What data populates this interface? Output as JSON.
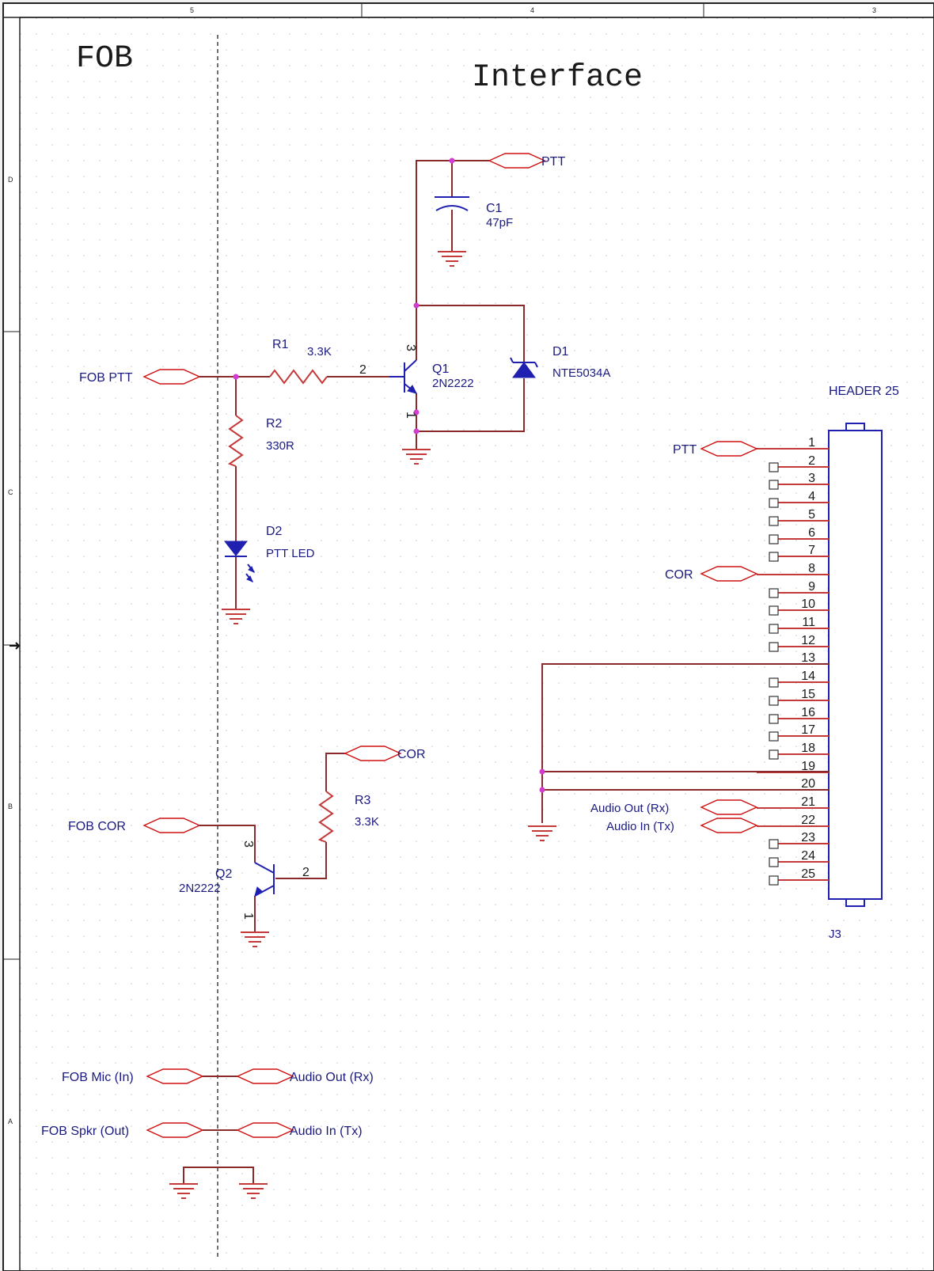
{
  "border": {
    "zones_top": [
      "5",
      "4",
      "3"
    ],
    "zones_left": [
      "D",
      "C",
      "B",
      "A"
    ]
  },
  "sections": {
    "left": "FOB",
    "right": "Interface"
  },
  "ports": {
    "fob_ptt": "FOB PTT",
    "ptt_top": "PTT",
    "fob_cor": "FOB COR",
    "cor": "COR",
    "fob_mic": "FOB Mic (In)",
    "fob_spkr": "FOB Spkr (Out)",
    "audio_out": "Audio Out (Rx)",
    "audio_in": "Audio In (Tx)",
    "hdr_ptt": "PTT",
    "hdr_cor": "COR",
    "hdr_audio_out": "Audio Out (Rx)",
    "hdr_audio_in": "Audio In (Tx)"
  },
  "components": {
    "c1": {
      "ref": "C1",
      "value": "47pF"
    },
    "r1": {
      "ref": "R1",
      "value": "3.3K"
    },
    "r2": {
      "ref": "R2",
      "value": "330R"
    },
    "r3": {
      "ref": "R3",
      "value": "3.3K"
    },
    "q1": {
      "ref": "Q1",
      "value": "2N2222",
      "pins": [
        "1",
        "2",
        "3"
      ]
    },
    "q2": {
      "ref": "Q2",
      "value": "2N2222",
      "pins": [
        "1",
        "2",
        "3"
      ]
    },
    "d1": {
      "ref": "D1",
      "value": "NTE5034A"
    },
    "d2": {
      "ref": "D2",
      "value": "PTT LED"
    },
    "j3": {
      "ref": "J3",
      "value": "HEADER 25",
      "pins": [
        "1",
        "2",
        "3",
        "4",
        "5",
        "6",
        "7",
        "8",
        "9",
        "10",
        "11",
        "12",
        "13",
        "14",
        "15",
        "16",
        "17",
        "18",
        "19",
        "20",
        "21",
        "22",
        "23",
        "24",
        "25"
      ]
    }
  }
}
